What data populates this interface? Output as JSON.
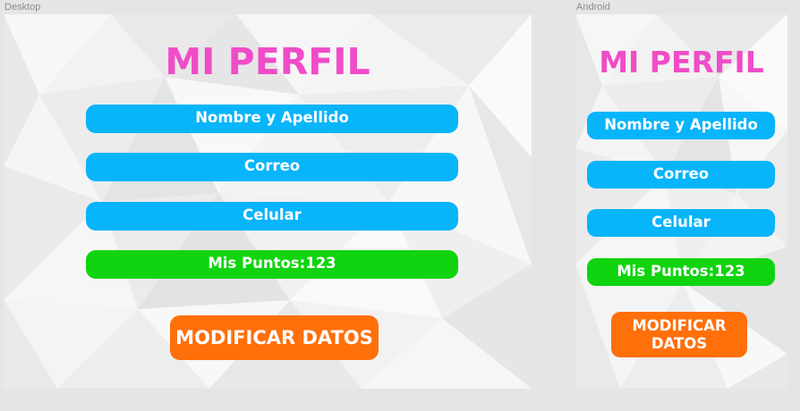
{
  "frames": {
    "desktop": {
      "label": "Desktop",
      "title": "MI PERFIL",
      "fields": {
        "name": "Nombre y Apellido",
        "email": "Correo",
        "phone": "Celular",
        "points": "Mis Puntos:123"
      },
      "modify_button": "MODIFICAR DATOS"
    },
    "android": {
      "label": "Android",
      "title": "MI PERFIL",
      "fields": {
        "name": "Nombre y Apellido",
        "email": "Correo",
        "phone": "Celular",
        "points": "Mis Puntos:123"
      },
      "modify_button": "MODIFICAR DATOS"
    }
  },
  "colors": {
    "canvas": "#e5e5e5",
    "title": "#f04cc8",
    "field": "#08b4fa",
    "points": "#0fd40f",
    "button": "#ff6f0a",
    "text_on_color": "#ffffff"
  }
}
